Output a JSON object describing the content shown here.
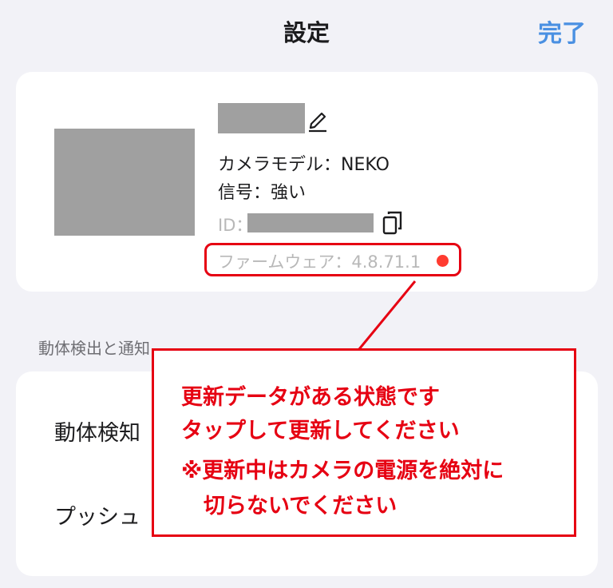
{
  "navbar": {
    "title": "設定",
    "done_label": "完了",
    "accent_color": "#4a90e2"
  },
  "camera_card": {
    "thumbnail": "redacted",
    "name": "redacted",
    "edit_icon": "pencil-icon",
    "model_text": "カメラモデル：NEKO",
    "signal_text": "信号：強い",
    "id_label": "ID：",
    "id_value": "redacted",
    "copy_icon": "copy-icon",
    "firmware_text": "ファームウェア：4.8.71.1",
    "update_indicator_color": "#ff3b30"
  },
  "section": {
    "header": "動体検出と通知"
  },
  "list": {
    "items": [
      {
        "label": "動体検知"
      },
      {
        "label": "プッシュ"
      }
    ]
  },
  "annotation": {
    "color": "#e60012",
    "lines": [
      "更新データがある状態です",
      "タップして更新してください",
      "※更新中はカメラの電源を絶対に",
      "切らないでください"
    ]
  }
}
